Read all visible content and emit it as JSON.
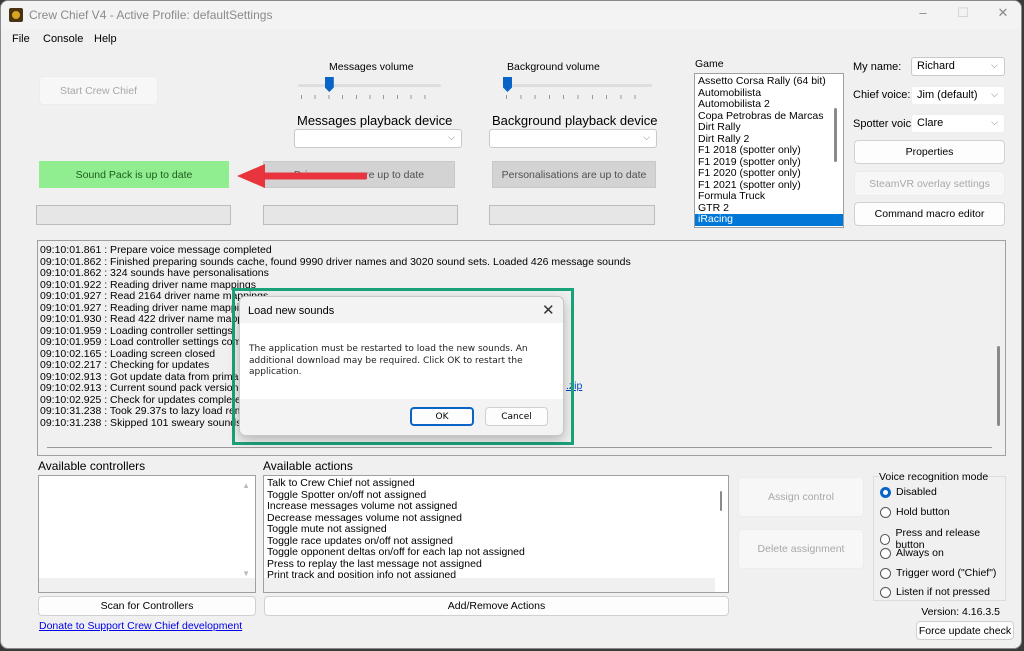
{
  "window": {
    "title": "Crew Chief V4 - Active Profile: defaultSettings",
    "minimize": "–",
    "maximize": "☐",
    "close": "✕"
  },
  "menu": [
    "File",
    "Console",
    "Help"
  ],
  "start_button": "Start Crew Chief",
  "messages_volume": {
    "label": "Messages volume",
    "value": 0.2
  },
  "background_volume": {
    "label": "Background volume",
    "value": 0
  },
  "messages_device": {
    "label": "Messages playback device",
    "value": ""
  },
  "background_device": {
    "label": "Background playback device",
    "value": ""
  },
  "status": {
    "sound_pack": "Sound Pack is up to date",
    "driver_names": "Driver names are up to date",
    "personalisations": "Personalisations are up to date"
  },
  "colors": {
    "sound_pack_ok": "#90ee90",
    "annotation_arrow": "#e8343c",
    "dialog_highlight": "#1aa37a",
    "accent": "#0078d7"
  },
  "game": {
    "label": "Game",
    "items": [
      "Assetto Corsa Rally (64 bit)",
      "Automobilista",
      "Automobilista 2",
      "Copa Petrobras de Marcas",
      "Dirt Rally",
      "Dirt Rally 2",
      "F1 2018 (spotter only)",
      "F1 2019 (spotter only)",
      "F1 2020 (spotter only)",
      "F1 2021 (spotter only)",
      "Formula Truck",
      "GTR 2",
      "iRacing"
    ],
    "selected": "iRacing"
  },
  "my_name": {
    "label": "My name:",
    "value": "Richard"
  },
  "chief_voice": {
    "label": "Chief voice:",
    "value": "Jim (default)"
  },
  "spotter_voice": {
    "label": "Spotter voice:",
    "value": "Clare"
  },
  "buttons": {
    "properties": "Properties",
    "steamvr": "SteamVR overlay settings",
    "macro": "Command macro editor",
    "scan": "Scan for Controllers",
    "add_remove": "Add/Remove Actions",
    "assign": "Assign control",
    "delete": "Delete assignment",
    "force_update": "Force update check"
  },
  "log": [
    "09:10:01.861 : Prepare voice message completed",
    "09:10:01.862 : Finished preparing sounds cache, found 9990 driver names and 3020 sound sets. Loaded 426 message sounds",
    "09:10:01.862 : 324 sounds have personalisations",
    "09:10:01.922 : Reading driver name mappings",
    "09:10:01.927 : Read 2164 driver name mappings",
    "09:10:01.927 : Reading driver name mappings",
    "09:10:01.930 : Read 422 driver name mappings",
    "09:10:01.959 : Loading controller settings",
    "09:10:01.959 : Load controller settings complete",
    "09:10:02.165 : Loading screen closed",
    "09:10:02.217 : Checking for updates",
    "09:10:02.913 : Got update data from primary UF",
    "09:10:02.913 : Current sound pack version 165",
    "09:10:02.925 : Check for updates completed",
    "09:10:31.238 : Took 29.37s to lazy load remaini",
    "09:10:31.238 : Skipped 101 sweary sounds"
  ],
  "log_link_fragment": ".zip",
  "dialog": {
    "title": "Load new sounds",
    "message": "The application must be restarted to load the new sounds. An additional download may be required. Click OK to restart the application.",
    "ok": "OK",
    "cancel": "Cancel"
  },
  "controllers": {
    "label": "Available controllers",
    "items": []
  },
  "actions": {
    "label": "Available actions",
    "items": [
      "Talk to Crew Chief not assigned",
      "Toggle Spotter on/off not assigned",
      "Increase messages volume not assigned",
      "Decrease messages volume not assigned",
      "Toggle mute not assigned",
      "Toggle race updates on/off not assigned",
      "Toggle opponent deltas on/off for each lap not assigned",
      "Press to replay the last message not assigned",
      "Print track and position info not assigned"
    ]
  },
  "donate_link": "Donate to Support Crew Chief development",
  "voice_recognition": {
    "label": "Voice recognition mode",
    "options": [
      "Disabled",
      "Hold button",
      "Press and release button",
      "Always on",
      "Trigger word (\"Chief\")",
      "Listen if not pressed"
    ],
    "selected": "Disabled"
  },
  "version": "Version: 4.16.3.5"
}
